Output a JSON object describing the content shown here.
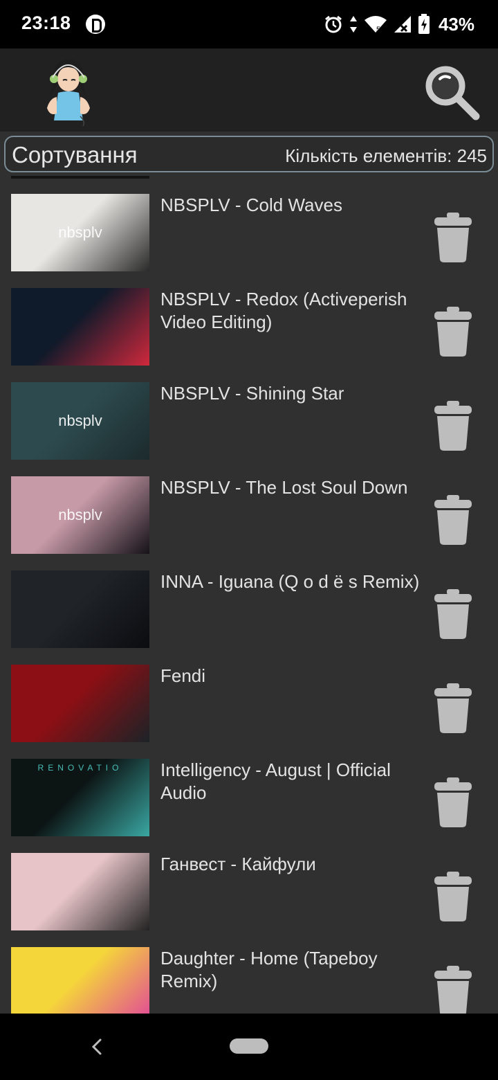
{
  "status_bar": {
    "time": "23:18",
    "battery": "43%",
    "icons": [
      "alarm-icon",
      "data-arrows-icon",
      "wifi-icon",
      "signal-icon",
      "battery-charging-icon"
    ]
  },
  "app_bar": {
    "avatar": "anime-girl-headphones-avatar",
    "search_icon": "search-icon"
  },
  "sort_bar": {
    "label": "Сортування",
    "count": "Кількість елементів: 245"
  },
  "items": [
    {
      "title": "NBSPLV - Cold Waves",
      "thumb_colors": [
        "#e8e6e2",
        "#2a2a2a"
      ],
      "thumb_text": "nbsplv"
    },
    {
      "title": "NBSPLV - Redox (Activeperish Video Editing)",
      "thumb_colors": [
        "#0f1a2a",
        "#d0283c"
      ],
      "thumb_text": ""
    },
    {
      "title": "NBSPLV - Shining Star",
      "thumb_colors": [
        "#2d4b4f",
        "#1c2a2c"
      ],
      "thumb_text": "nbsplv"
    },
    {
      "title": "NBSPLV - The Lost Soul Down",
      "thumb_colors": [
        "#c79aa8",
        "#151218"
      ],
      "thumb_text": "nbsplv"
    },
    {
      "title": "INNA - Iguana (Q o d ё s Remix)",
      "thumb_colors": [
        "#202428",
        "#0a0c10"
      ],
      "thumb_text": ""
    },
    {
      "title": "Fendi",
      "thumb_colors": [
        "#8b0f14",
        "#1b2327"
      ],
      "thumb_text": ""
    },
    {
      "title": "Intelligency - August | Official Audio",
      "thumb_colors": [
        "#0c1414",
        "#3aa7a2"
      ],
      "thumb_text": "RENOVATIO"
    },
    {
      "title": "Ганвест - Кайфули",
      "thumb_colors": [
        "#e7c4c8",
        "#232323"
      ],
      "thumb_text": ""
    },
    {
      "title": "Daughter - Home (Tapeboy Remix)",
      "thumb_colors": [
        "#f5d63a",
        "#e0449a"
      ],
      "thumb_text": ""
    }
  ],
  "nav_bar": {
    "back_icon": "back-icon",
    "home_icon": "home-pill-icon"
  }
}
